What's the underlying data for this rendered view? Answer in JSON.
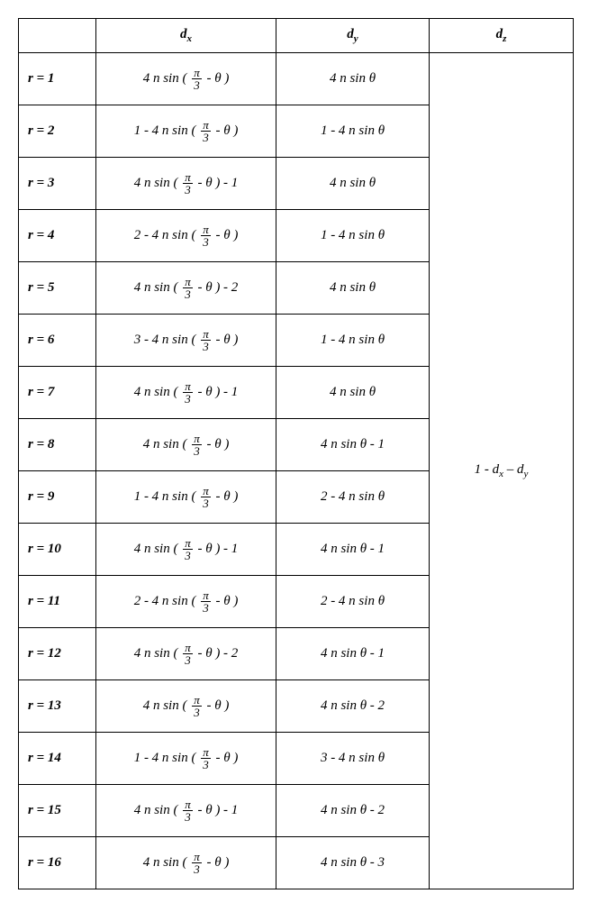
{
  "headers": {
    "col0": "",
    "dx": "d",
    "dx_sub": "x",
    "dy": "d",
    "dy_sub": "y",
    "dz": "d",
    "dz_sub": "z"
  },
  "frac": {
    "num": "π",
    "den": "3"
  },
  "dz_expr_prefix": "1 - d",
  "dz_expr_mid_sub": "x",
  "dz_expr_sep": " – d",
  "dz_expr_end_sub": "y",
  "rows": [
    {
      "label": "r = 1",
      "dx_pre": "4 n sin ( ",
      "dx_post": " - θ )",
      "dy": "4 n sin θ"
    },
    {
      "label": "r = 2",
      "dx_pre": "1 - 4 n sin ( ",
      "dx_post": " - θ )",
      "dy": "1 - 4 n sin θ"
    },
    {
      "label": "r = 3",
      "dx_pre": "4 n sin ( ",
      "dx_post": " - θ ) - 1",
      "dy": "4 n sin θ"
    },
    {
      "label": "r = 4",
      "dx_pre": "2 - 4 n sin ( ",
      "dx_post": " - θ )",
      "dy": "1 - 4 n sin θ"
    },
    {
      "label": "r = 5",
      "dx_pre": "4 n sin ( ",
      "dx_post": " - θ ) - 2",
      "dy": "4 n sin θ"
    },
    {
      "label": "r = 6",
      "dx_pre": "3 - 4 n sin ( ",
      "dx_post": " - θ )",
      "dy": "1 - 4 n sin θ"
    },
    {
      "label": "r = 7",
      "dx_pre": "4 n sin ( ",
      "dx_post": " - θ ) - 1",
      "dy": "4 n sin θ"
    },
    {
      "label": "r = 8",
      "dx_pre": "4 n sin ( ",
      "dx_post": " - θ )",
      "dy": "4 n sin θ - 1"
    },
    {
      "label": "r = 9",
      "dx_pre": "1 - 4 n sin ( ",
      "dx_post": " - θ )",
      "dy": "2 - 4 n sin θ"
    },
    {
      "label": "r = 10",
      "dx_pre": "4 n sin ( ",
      "dx_post": " - θ ) - 1",
      "dy": "4 n sin θ - 1"
    },
    {
      "label": "r = 11",
      "dx_pre": "2 - 4 n sin ( ",
      "dx_post": " - θ )",
      "dy": "2 - 4 n sin θ"
    },
    {
      "label": "r = 12",
      "dx_pre": "4 n sin ( ",
      "dx_post": " - θ ) - 2",
      "dy": "4 n sin θ - 1"
    },
    {
      "label": "r = 13",
      "dx_pre": "4 n sin ( ",
      "dx_post": " - θ )",
      "dy": "4 n sin θ - 2"
    },
    {
      "label": "r = 14",
      "dx_pre": "1 - 4 n sin ( ",
      "dx_post": " - θ )",
      "dy": "3 - 4 n sin θ"
    },
    {
      "label": "r = 15",
      "dx_pre": "4 n sin ( ",
      "dx_post": " - θ ) - 1",
      "dy": "4 n sin θ - 2"
    },
    {
      "label": "r = 16",
      "dx_pre": "4 n sin ( ",
      "dx_post": " - θ )",
      "dy": "4 n sin θ - 3"
    }
  ]
}
